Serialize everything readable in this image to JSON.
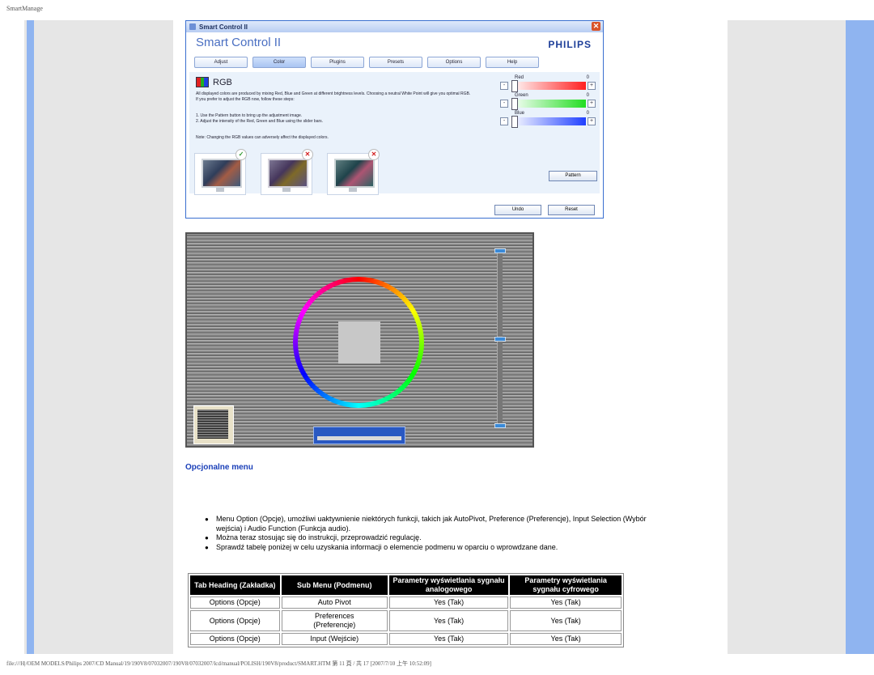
{
  "page": {
    "header_title": "SmartManage",
    "footer_text": "file:///H|/OEM MODELS/Philips 2007/CD Manual/19/190V8/07032007/190V8/07032007/lcd/manual/POLISH/190V8/product/SMART.HTM 第 11 頁 / 共 17 [2007/7/10 上午 10:52:09]"
  },
  "smart_control": {
    "window_title": "Smart Control II",
    "app_name": "Smart Control II",
    "brand": "PHILIPS",
    "tabs": [
      "Adjust",
      "Color",
      "Plugins",
      "Presets",
      "Options",
      "Help"
    ],
    "active_tab": "Color",
    "panel_title": "RGB",
    "description_1": "All displayed colors are produced by mixing Red, Blue and Green at different brightness levels. Choosing a neutral White Point will give you optimal RGB. If you prefer to adjust the RGB now, follow these steps:",
    "description_2": "1. Use the Pattern button to bring up the adjustment image.",
    "description_3": "2. Adjust the intensity of the Red, Green and Blue using the slider bars.",
    "description_4": "Note: Changing the RGB values can adversely affect the displayed colors.",
    "sliders": [
      {
        "label": "Red",
        "value": "0",
        "color": "#ff2020"
      },
      {
        "label": "Green",
        "value": "0",
        "color": "#22dd22"
      },
      {
        "label": "Blue",
        "value": "0",
        "color": "#2040ff"
      }
    ],
    "pattern_button": "Pattern",
    "undo_button": "Undo",
    "reset_button": "Reset"
  },
  "options_section": {
    "heading": "Opcjonalne menu",
    "bullets": [
      "Menu Option (Opcje), umożliwi uaktywnienie niektórych funkcji, takich jak AutoPivot, Preference (Preferencje), Input Selection (Wybór wejścia) i Audio Function (Funkcja audio).",
      "Można teraz stosując się do instrukcji, przeprowadzić regulację.",
      "Sprawdź tabelę poniżej w celu uzyskania informacji o elemencie podmenu w oparciu o wprowdzane dane."
    ]
  },
  "table": {
    "headers": [
      "Tab Heading (Zakładka)",
      "Sub Menu (Podmenu)",
      "Parametry wyświetlania sygnału analogowego",
      "Parametry wyświetlania sygnału cyfrowego"
    ],
    "rows": [
      [
        "Options (Opcje)",
        "Auto Pivot",
        "Yes (Tak)",
        "Yes (Tak)"
      ],
      [
        "Options (Opcje)",
        "Preferences (Preferencje)",
        "Yes (Tak)",
        "Yes (Tak)"
      ],
      [
        "Options (Opcje)",
        "Input (Wejście)",
        "Yes (Tak)",
        "Yes (Tak)"
      ]
    ]
  }
}
